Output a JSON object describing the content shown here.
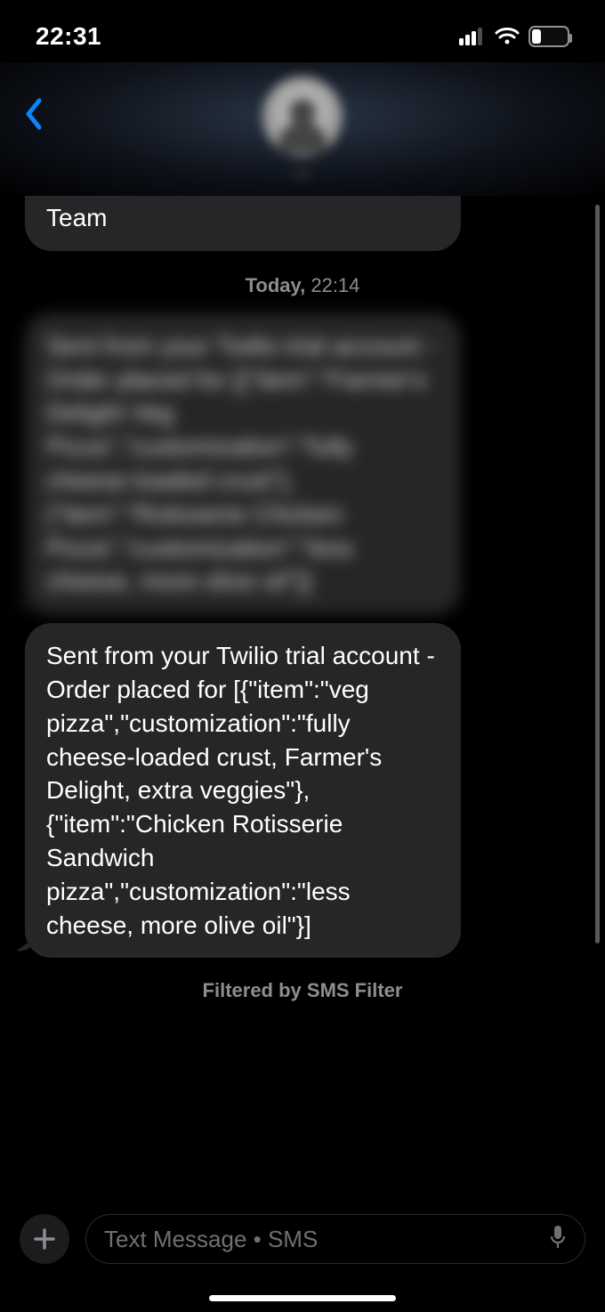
{
  "status": {
    "time": "22:31",
    "battery_percent": "25"
  },
  "header": {
    "contact_name_blurred": "—"
  },
  "thread": {
    "prev_tail": "Team",
    "timestamp_day": "Today,",
    "timestamp_time": "22:14",
    "system_note_blurred": "",
    "msg_blurred": "Sent from your Twilio trial account - Order placed for [{\"item\":\"Farmer's Delight Veg Pizza\",\"customization\":\"fully cheese-loaded crust\"},{\"item\":\"Rotisserie Chicken Pizza\",\"customization\":\"less cheese, more olive oil\"}]",
    "msg_visible": "Sent from your Twilio trial account - Order placed for [{\"item\":\"veg pizza\",\"customization\":\"fully cheese-loaded crust, Farmer's Delight, extra veggies\"},{\"item\":\"Chicken Rotisserie Sandwich pizza\",\"customization\":\"less cheese, more olive oil\"}]",
    "filter_note": "Filtered by SMS Filter"
  },
  "composer": {
    "placeholder": "Text Message • SMS"
  }
}
